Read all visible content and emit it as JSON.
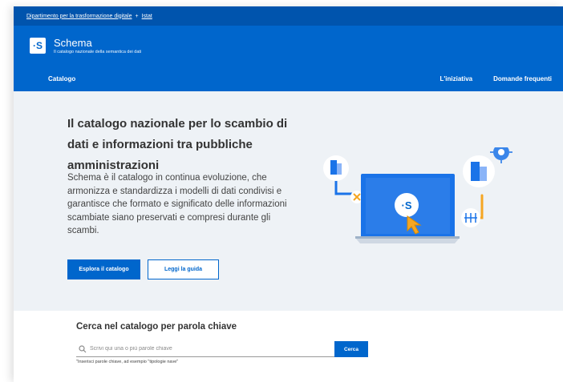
{
  "slim_header": {
    "link1": "Dipartimento per la trasformazione digitale",
    "separator": "+",
    "link2": "Istat"
  },
  "brand": {
    "logo": "·S",
    "title": "Schema",
    "subtitle": "Il catalogo nazionale della semantica dei dati"
  },
  "nav": {
    "catalog": "Catalogo",
    "initiative": "L'iniziativa",
    "faq": "Domande frequenti"
  },
  "hero": {
    "title": "Il catalogo nazionale per lo scambio di dati e informazioni tra pubbliche amministrazioni",
    "description": "Schema è il catalogo in continua evoluzione, che armonizza e standardizza i modelli di dati condivisi e garantisce che formato e significato delle informazioni scambiate siano preservati e compresi durante gli scambi.",
    "primary_button": "Esplora il catalogo",
    "secondary_button": "Leggi la guida",
    "illustration_logo": "·S"
  },
  "search": {
    "title": "Cerca nel catalogo per parola chiave",
    "placeholder": "Scrivi qui una o più parole chiave",
    "button": "Cerca",
    "hint": "\"Inserisci parole chiave, ad esempio \"tipologie nave\""
  },
  "colors": {
    "primary": "#0066cc",
    "slim_header": "#0054ad",
    "hero_bg": "#eef2f6",
    "accent": "#f5a623"
  },
  "icons": {
    "search": "search-icon",
    "illustration": "laptop-network-illustration"
  }
}
